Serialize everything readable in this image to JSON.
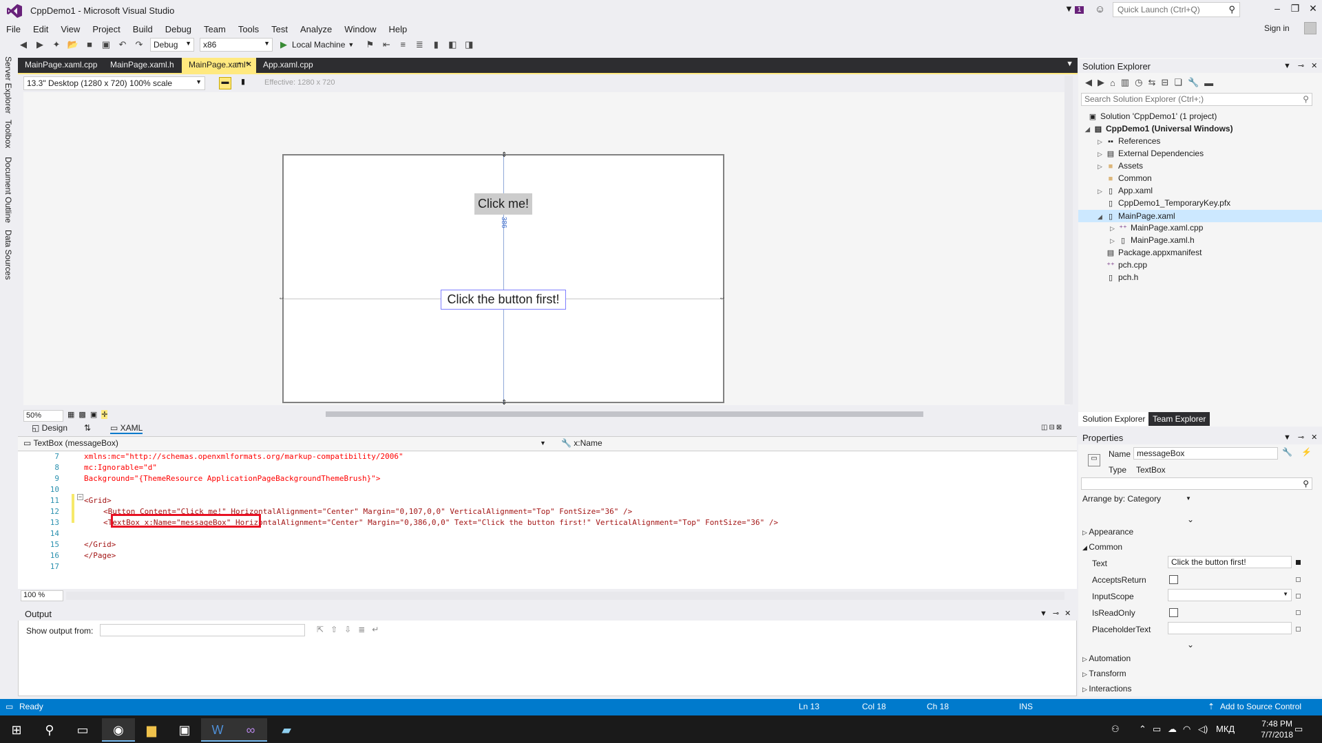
{
  "window": {
    "title": "CppDemo1 - Microsoft Visual Studio",
    "notif_count": "1",
    "quick_launch_placeholder": "Quick Launch (Ctrl+Q)",
    "sign_in": "Sign in"
  },
  "menu": [
    "File",
    "Edit",
    "View",
    "Project",
    "Build",
    "Debug",
    "Team",
    "Tools",
    "Test",
    "Analyze",
    "Window",
    "Help"
  ],
  "toolbar": {
    "config": "Debug",
    "platform": "x86",
    "run_target": "Local Machine"
  },
  "left_rail": [
    "Server Explorer",
    "Toolbox",
    "Document Outline",
    "Data Sources"
  ],
  "doc_tabs": [
    {
      "label": "MainPage.xaml.cpp"
    },
    {
      "label": "MainPage.xaml.h"
    },
    {
      "label": "MainPage.xaml*"
    },
    {
      "label": "App.xaml.cpp"
    }
  ],
  "designer": {
    "device": "13.3\" Desktop (1280 x 720) 100% scale",
    "effective": "Effective: 1280 x 720",
    "button_text": "Click me!",
    "textbox_text": "Click the button first!",
    "margin_label": "386",
    "zoom": "50%"
  },
  "view_tabs": {
    "design": "Design",
    "swap": "⇅",
    "xaml": "XAML"
  },
  "scope": {
    "element": "TextBox (messageBox)",
    "property": "x:Name"
  },
  "code_lines": [
    {
      "num": "7",
      "text": "xmlns:mc=\"http://schemas.openxmlformats.org/markup-compatibility/2006\""
    },
    {
      "num": "8",
      "text": "mc:Ignorable=\"d\""
    },
    {
      "num": "9",
      "text": "Background=\"{ThemeResource ApplicationPageBackgroundThemeBrush}\">"
    },
    {
      "num": "10",
      "text": ""
    },
    {
      "num": "11",
      "text": "<Grid>"
    },
    {
      "num": "12",
      "text": "<Button Content=\"Click me!\" HorizontalAlignment=\"Center\" Margin=\"0,107,0,0\" VerticalAlignment=\"Top\" FontSize=\"36\" />"
    },
    {
      "num": "13",
      "text": "<TextBox x:Name=\"messageBox\" HorizontalAlignment=\"Center\" Margin=\"0,386,0,0\" Text=\"Click the button first!\" VerticalAlignment=\"Top\" FontSize=\"36\" />"
    },
    {
      "num": "14",
      "text": ""
    },
    {
      "num": "15",
      "text": "</Grid>"
    },
    {
      "num": "16",
      "text": "</Page>"
    },
    {
      "num": "17",
      "text": ""
    }
  ],
  "editor_zoom": "100 %",
  "output": {
    "title": "Output",
    "show_from": "Show output from:"
  },
  "solution_explorer": {
    "title": "Solution Explorer",
    "search_placeholder": "Search Solution Explorer (Ctrl+;)",
    "items": [
      {
        "label": "Solution 'CppDemo1' (1 project)",
        "icon": "solution-icon"
      },
      {
        "label": "CppDemo1 (Universal Windows)",
        "icon": "project-icon"
      },
      {
        "label": "References",
        "icon": "references-icon"
      },
      {
        "label": "External Dependencies",
        "icon": "dependencies-icon"
      },
      {
        "label": "Assets",
        "icon": "folder-icon"
      },
      {
        "label": "Common",
        "icon": "folder-icon"
      },
      {
        "label": "App.xaml",
        "icon": "xaml-file-icon"
      },
      {
        "label": "CppDemo1_TemporaryKey.pfx",
        "icon": "key-file-icon"
      },
      {
        "label": "MainPage.xaml",
        "icon": "xaml-file-icon"
      },
      {
        "label": "MainPage.xaml.cpp",
        "icon": "cpp-file-icon"
      },
      {
        "label": "MainPage.xaml.h",
        "icon": "header-file-icon"
      },
      {
        "label": "Package.appxmanifest",
        "icon": "manifest-icon"
      },
      {
        "label": "pch.cpp",
        "icon": "cpp-file-icon"
      },
      {
        "label": "pch.h",
        "icon": "header-file-icon"
      }
    ],
    "tabs": [
      "Solution Explorer",
      "Team Explorer"
    ]
  },
  "properties": {
    "title": "Properties",
    "name_label": "Name",
    "name_value": "messageBox",
    "type_label": "Type",
    "type_value": "TextBox",
    "arrange_by": "Arrange by: Category",
    "appearance": "Appearance",
    "common": "Common",
    "text_label": "Text",
    "text_value": "Click the button first!",
    "accepts_return": "AcceptsReturn",
    "input_scope": "InputScope",
    "is_read_only": "IsReadOnly",
    "placeholder_text": "PlaceholderText",
    "automation": "Automation",
    "transform": "Transform",
    "interactions": "Interactions"
  },
  "status": {
    "ready": "Ready",
    "ln": "Ln 13",
    "col": "Col 18",
    "ch": "Ch 18",
    "ins": "INS",
    "source_control": "Add to Source Control"
  },
  "taskbar": {
    "lang": "МКД",
    "time": "7:48 PM",
    "date": "7/7/2018"
  },
  "colors": {
    "accent": "#007acc",
    "tab_active": "#ffe97f",
    "highlight_red": "#e81123"
  }
}
